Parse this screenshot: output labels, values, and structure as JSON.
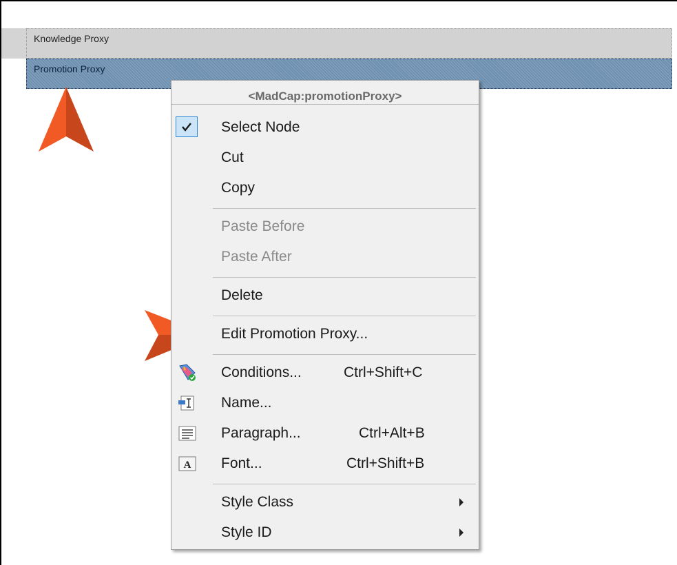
{
  "proxies": {
    "knowledge": "Knowledge Proxy",
    "promotion": "Promotion Proxy"
  },
  "context_menu": {
    "header": "<MadCap:promotionProxy>",
    "items": {
      "select_node": {
        "label": "Select Node",
        "checked": true
      },
      "cut": {
        "label": "Cut"
      },
      "copy": {
        "label": "Copy"
      },
      "paste_before": {
        "label": "Paste Before",
        "disabled": true
      },
      "paste_after": {
        "label": "Paste After",
        "disabled": true
      },
      "delete": {
        "label": "Delete"
      },
      "edit_promotion_proxy": {
        "label": "Edit Promotion Proxy..."
      },
      "conditions": {
        "label": "Conditions...",
        "shortcut": "Ctrl+Shift+C",
        "icon": "conditions-icon"
      },
      "name": {
        "label": "Name...",
        "icon": "name-icon"
      },
      "paragraph": {
        "label": "Paragraph...",
        "shortcut": "Ctrl+Alt+B",
        "icon": "paragraph-icon"
      },
      "font": {
        "label": "Font...",
        "shortcut": "Ctrl+Shift+B",
        "icon": "font-icon"
      },
      "style_class": {
        "label": "Style Class",
        "submenu": true
      },
      "style_id": {
        "label": "Style ID",
        "submenu": true
      }
    }
  },
  "colors": {
    "annotation_arrow": "#f15a24",
    "selection": "#6d8fb0",
    "menu_background": "#f0f0f0"
  }
}
